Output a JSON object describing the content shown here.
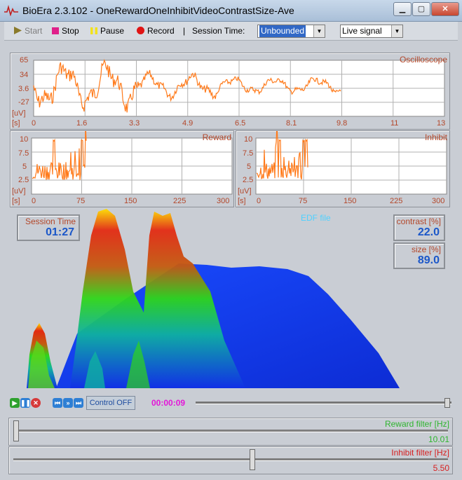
{
  "window": {
    "title": "BioEra 2.3.102 - OneRewardOneInhibitVideoContrastSize-Ave",
    "min_glyph": "▁",
    "max_glyph": "▢",
    "close_glyph": "✕"
  },
  "toolbar": {
    "start_label": "Start",
    "stop_label": "Stop",
    "pause_label": "Pause",
    "record_label": "Record",
    "separator": "|",
    "session_time_label": "Session Time:",
    "session_time_value": "Unbounded",
    "signal_value": "Live signal"
  },
  "oscilloscope": {
    "title": "Oscilloscope",
    "y_unit": "[uV]",
    "x_unit": "[s]",
    "y_ticks": [
      "65",
      "34",
      "3.6",
      "-27"
    ],
    "x_ticks": [
      "0",
      "1.6",
      "3.3",
      "4.9",
      "6.5",
      "8.1",
      "9.8",
      "11",
      "13"
    ],
    "trace_color": "#ff7a1a"
  },
  "reward": {
    "title": "Reward",
    "y_unit": "[uV]",
    "x_unit": "[s]",
    "y_ticks": [
      "10",
      "7.5",
      "5",
      "2.5"
    ],
    "x_ticks": [
      "0",
      "75",
      "150",
      "225",
      "300"
    ]
  },
  "inhibit": {
    "title": "Inhibit",
    "y_unit": "[uV]",
    "x_unit": "[s]",
    "y_ticks": [
      "10",
      "7.5",
      "5",
      "2.5"
    ],
    "x_ticks": [
      "0",
      "75",
      "150",
      "225",
      "300"
    ]
  },
  "session": {
    "label": "Session Time",
    "value": "01:27"
  },
  "contrast": {
    "label": "contrast [%]",
    "value": "22.0"
  },
  "size": {
    "label": "size [%]",
    "value": "89.0"
  },
  "edf_label": "EDF file",
  "playback": {
    "control_label": "Control  OFF",
    "time": "00:00:09",
    "position": 0.99
  },
  "reward_filter": {
    "label": "Reward filter [Hz]",
    "value": "10.01",
    "position": 0.0,
    "color": "#2fb52f"
  },
  "inhibit_filter": {
    "label": "Inhibit filter [Hz]",
    "value": "5.50",
    "position": 0.55,
    "color": "#d61f1f"
  }
}
